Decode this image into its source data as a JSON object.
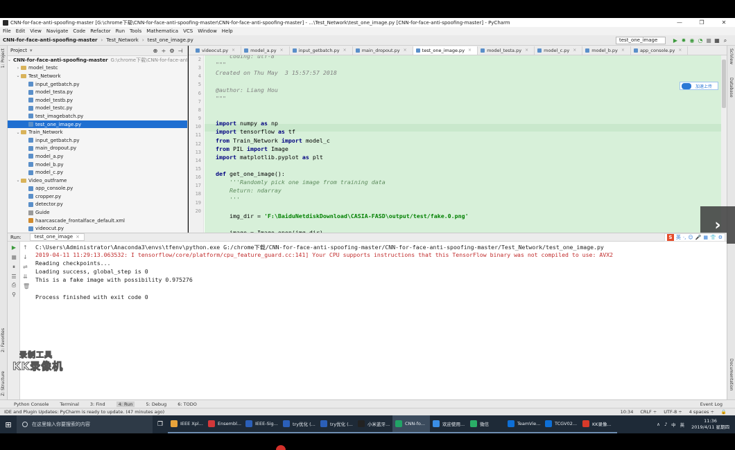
{
  "window": {
    "title": "CNN-for-face-anti-spoofing-master [G:\\chrome下载\\CNN-for-face-anti-spoofing-master\\CNN-for-face-anti-spoofing-master] - ...\\Test_Network\\test_one_image.py [CNN-for-face-anti-spoofing-master] - PyCharm",
    "min": "—",
    "restore": "❐",
    "close": "✕"
  },
  "menu": [
    "File",
    "Edit",
    "View",
    "Navigate",
    "Code",
    "Refactor",
    "Run",
    "Tools",
    "Mathematica",
    "VCS",
    "Window",
    "Help"
  ],
  "navbar": {
    "crumbs": [
      "CNN-for-face-anti-spoofing-master",
      "Test_Network",
      "test_one_image.py"
    ],
    "run_config": "test_one_image"
  },
  "sidestrip": {
    "project": "1: Project",
    "structure": "Z: Structure",
    "favorites": "2: Favorites",
    "scview": "SciView",
    "database": "Database",
    "documentation": "Documentation"
  },
  "project": {
    "header": "Project",
    "root": "CNN-for-face-anti-spoofing-master",
    "root_path": "G:\\chrome下载\\CNN-for-face-anti",
    "items": [
      {
        "label": "model_testc",
        "depth": 1,
        "kind": "folder",
        "arrow": "›"
      },
      {
        "label": "Test_Network",
        "depth": 1,
        "kind": "folder",
        "arrow": "⌄"
      },
      {
        "label": "input_getbatch.py",
        "depth": 2,
        "kind": "py"
      },
      {
        "label": "model_testa.py",
        "depth": 2,
        "kind": "py"
      },
      {
        "label": "model_testb.py",
        "depth": 2,
        "kind": "py"
      },
      {
        "label": "model_testc.py",
        "depth": 2,
        "kind": "py"
      },
      {
        "label": "test_imagebatch.py",
        "depth": 2,
        "kind": "py"
      },
      {
        "label": "test_one_image.py",
        "depth": 2,
        "kind": "py",
        "selected": true
      },
      {
        "label": "Train_Network",
        "depth": 1,
        "kind": "folder",
        "arrow": "⌄"
      },
      {
        "label": "input_getbatch.py",
        "depth": 2,
        "kind": "py"
      },
      {
        "label": "main_dropout.py",
        "depth": 2,
        "kind": "py"
      },
      {
        "label": "model_a.py",
        "depth": 2,
        "kind": "py"
      },
      {
        "label": "model_b.py",
        "depth": 2,
        "kind": "py"
      },
      {
        "label": "model_c.py",
        "depth": 2,
        "kind": "py"
      },
      {
        "label": "Video_outframe",
        "depth": 1,
        "kind": "folder",
        "arrow": "⌄"
      },
      {
        "label": "app_console.py",
        "depth": 2,
        "kind": "py"
      },
      {
        "label": "cropper.py",
        "depth": 2,
        "kind": "py"
      },
      {
        "label": "detector.py",
        "depth": 2,
        "kind": "py"
      },
      {
        "label": "Guide",
        "depth": 2,
        "kind": "dir"
      },
      {
        "label": "haarcascade_frontalface_default.xml",
        "depth": 2,
        "kind": "xml"
      },
      {
        "label": "videocut.py",
        "depth": 2,
        "kind": "py"
      }
    ]
  },
  "tabs": [
    {
      "label": "videocut.py"
    },
    {
      "label": "model_a.py"
    },
    {
      "label": "input_getbatch.py"
    },
    {
      "label": "main_dropout.py"
    },
    {
      "label": "test_one_image.py",
      "active": true
    },
    {
      "label": "model_testa.py"
    },
    {
      "label": "model_c.py"
    },
    {
      "label": "model_b.py"
    },
    {
      "label": "app_console.py"
    }
  ],
  "code": {
    "line_numbers": [
      "2",
      "3",
      "4",
      "5",
      "6",
      "7",
      "8",
      "9",
      "10",
      "11",
      "12",
      "13",
      "14",
      "15",
      "16",
      "17",
      "18",
      "19",
      "20"
    ],
    "lines": [
      "    coding: utf-8",
      "\"\"\"",
      "Created on Thu May  3 15:57:57 2018",
      "",
      "@author: Liang Hou",
      "\"\"\"",
      "",
      "",
      "import numpy as np",
      "import tensorflow as tf",
      "from Train_Network import model_c",
      "from PIL import Image",
      "import matplotlib.pyplot as plt",
      "",
      "def get_one_image():",
      "    '''Randomly pick one image from training data",
      "    Return: ndarray",
      "    '''",
      "",
      "    img_dir = 'F:\\BaiduNetdiskDownload\\CASIA-FASD\\output/test/fake.0.png'",
      "",
      "    image = Image.open(img_dir)"
    ],
    "upload_badge": "加速上传"
  },
  "run": {
    "label": "Run:",
    "tab": "test_one_image",
    "ime_labels": [
      "英",
      "·,",
      "☺",
      "🎤",
      "▦",
      "👕",
      "⚙"
    ],
    "output": [
      {
        "text": "C:\\Users\\Administrator\\Anaconda3\\envs\\tfenv\\python.exe G:/chrome下载/CNN-for-face-anti-spoofing-master/CNN-for-face-anti-spoofing-master/Test_Network/test_one_image.py",
        "type": "normal"
      },
      {
        "text": "2019-04-11 11:29:13.063532: I tensorflow/core/platform/cpu_feature_guard.cc:141] Your CPU supports instructions that this TensorFlow binary was not compiled to use: AVX2",
        "type": "err"
      },
      {
        "text": "Reading checkpoints...",
        "type": "normal"
      },
      {
        "text": "Loading success, global_step is 0",
        "type": "normal"
      },
      {
        "text": "This is a fake image with possibility 0.975276",
        "type": "normal"
      },
      {
        "text": "",
        "type": "normal"
      },
      {
        "text": "Process finished with exit code 0",
        "type": "normal"
      }
    ]
  },
  "watermark": {
    "line1": "录制工具",
    "line2": "KK录像机"
  },
  "bottom_tabs": [
    "Python Console",
    "Terminal",
    "3: Find",
    "4: Run",
    "5: Debug",
    "6: TODO"
  ],
  "event_log": "Event Log",
  "status": {
    "message": "IDE and Plugin Updates: PyCharm is ready to update. (47 minutes ago)",
    "position": "10:34",
    "line_sep": "CRLF ÷",
    "encoding": "UTF-8 ÷",
    "indent": "4 spaces ÷"
  },
  "taskbar": {
    "search_placeholder": "在这里输入你要搜索的内容",
    "apps": [
      {
        "label": "IEEE Xpl...",
        "color": "#e8a33b"
      },
      {
        "label": "Ensembl...",
        "color": "#d2383a"
      },
      {
        "label": "IEEE-Sig...",
        "color": "#2b5fb8"
      },
      {
        "label": "try优化 (...",
        "color": "#2b5fb8"
      },
      {
        "label": "try优化 (...",
        "color": "#2b5fb8"
      },
      {
        "label": "小米蓝牙...",
        "color": "#222"
      },
      {
        "label": "CNN-fo...",
        "color": "#21a366",
        "active": true
      },
      {
        "label": "欢迎使用...",
        "color": "#3a8ee6"
      },
      {
        "label": "微信",
        "color": "#2aae67"
      },
      {
        "label": "TeamVie...",
        "color": "#0e6fd6"
      },
      {
        "label": "TCGV02...",
        "color": "#0e6fd6"
      },
      {
        "label": "KK录像...",
        "color": "#d73a2a"
      }
    ],
    "tray": [
      "∧",
      "♪",
      "中",
      "英"
    ],
    "time": "11:36",
    "date": "2019/4/11 星期四"
  }
}
